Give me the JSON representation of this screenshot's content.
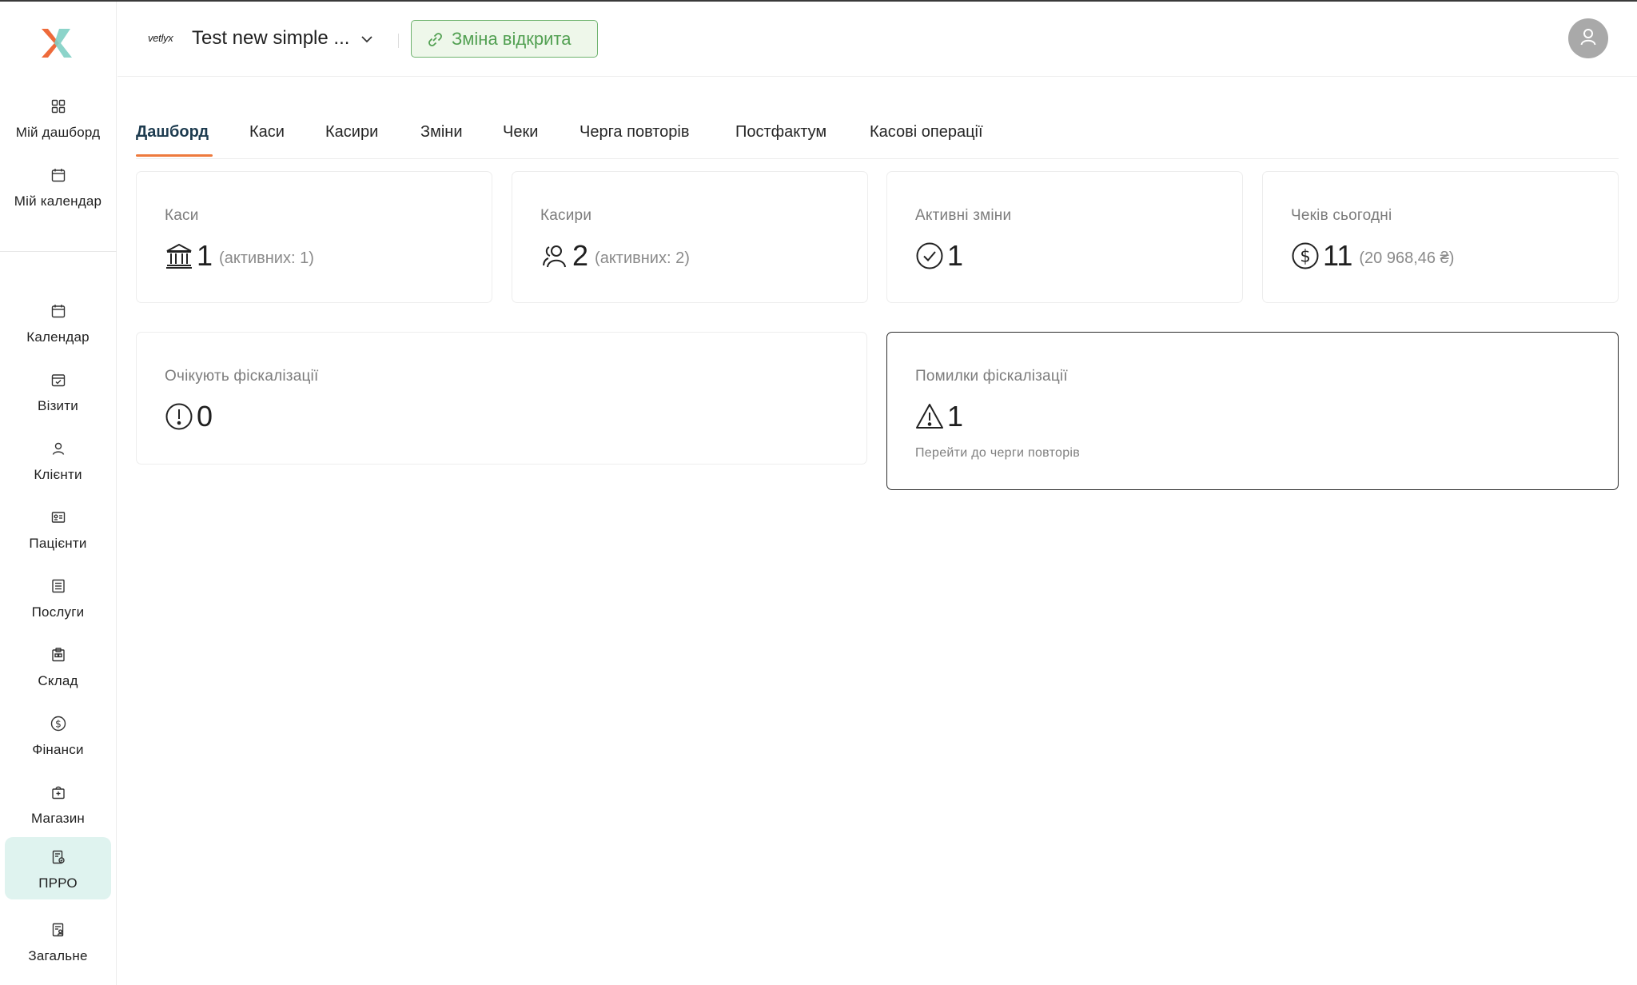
{
  "sidebar": {
    "top_items": [
      {
        "label": "Мій дашборд",
        "icon": "grid-icon"
      },
      {
        "label": "Мій календар",
        "icon": "calendar-icon"
      }
    ],
    "items": [
      {
        "label": "Календар",
        "icon": "calendar-icon"
      },
      {
        "label": "Візити",
        "icon": "calendar-check-icon"
      },
      {
        "label": "Клієнти",
        "icon": "users-icon"
      },
      {
        "label": "Пацієнти",
        "icon": "id-card-icon"
      },
      {
        "label": "Послуги",
        "icon": "list-icon"
      },
      {
        "label": "Склад",
        "icon": "warehouse-icon"
      },
      {
        "label": "Фінанси",
        "icon": "dollar-circle-icon"
      },
      {
        "label": "Магазин",
        "icon": "shop-bag-icon"
      },
      {
        "label": "ПРРО",
        "icon": "receipt-icon"
      },
      {
        "label": "Загальне",
        "icon": "document-user-icon"
      }
    ],
    "active_item": "ПРРО",
    "accent": "#dff3ef"
  },
  "header": {
    "brand_mini": "vetlyx",
    "project_name": "Test new simple ...",
    "shift_status": "Зміна відкрита",
    "shift_color": "#52a052"
  },
  "tabs": {
    "items": [
      "Дашборд",
      "Каси",
      "Касири",
      "Зміни",
      "Чеки",
      "Черга повторів",
      "Постфактум",
      "Касові операції"
    ],
    "active": "Дашборд",
    "accent": "#ee7a3d"
  },
  "cards": {
    "registers": {
      "title": "Каси",
      "value": "1",
      "sub": "(активних: 1)"
    },
    "cashiers": {
      "title": "Касири",
      "value": "2",
      "sub": "(активних: 2)"
    },
    "active_shifts": {
      "title": "Активні зміни",
      "value": "1"
    },
    "checks_today": {
      "title": "Чеків сьогодні",
      "value": "11",
      "sub": "(20 968,46 ₴)"
    },
    "pending_fiscal": {
      "title": "Очікують фіскалізації",
      "value": "0"
    },
    "fiscal_errors": {
      "title": "Помилки фіскалізації",
      "value": "1",
      "link": "Перейти до черги повторів"
    }
  }
}
